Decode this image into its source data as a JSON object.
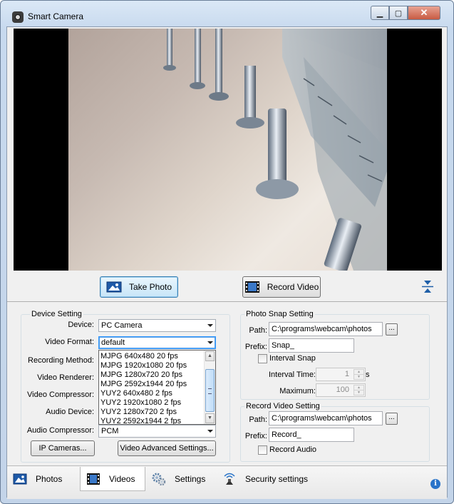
{
  "window": {
    "title": "Smart Camera"
  },
  "actions": {
    "take_photo": "Take Photo",
    "record_video": "Record Video"
  },
  "device_setting": {
    "legend": "Device Setting",
    "device_label": "Device:",
    "device_value": "PC Camera",
    "video_format_label": "Video Format:",
    "video_format_value": "default",
    "video_format_options": [
      "MJPG 640x480 20 fps",
      "MJPG 1920x1080 20 fps",
      "MJPG 1280x720 20 fps",
      "MJPG 2592x1944 20 fps",
      "YUY2 640x480 2 fps",
      "YUY2 1920x1080 2 fps",
      "YUY2 1280x720 2 fps",
      "YUY2 2592x1944 2 fps"
    ],
    "recording_method_label": "Recording Method:",
    "video_renderer_label": "Video Renderer:",
    "video_compressor_label": "Video Compressor:",
    "audio_device_label": "Audio Device:",
    "audio_compressor_label": "Audio Compressor:",
    "audio_compressor_value": "PCM",
    "ip_cameras_button": "IP Cameras...",
    "video_advanced_button": "Video Advanced Settings..."
  },
  "photo_snap": {
    "legend": "Photo Snap Setting",
    "path_label": "Path:",
    "path_value": "C:\\programs\\webcam\\photos",
    "browse_label": "...",
    "prefix_label": "Prefix:",
    "prefix_value": "Snap_",
    "interval_snap_label": "Interval Snap",
    "interval_time_label": "Interval Time:",
    "interval_time_value": "1",
    "interval_unit": "s",
    "maximum_label": "Maximum:",
    "maximum_value": "100"
  },
  "record_video": {
    "legend": "Record Video Setting",
    "path_label": "Path:",
    "path_value": "C:\\programs\\webcam\\photos",
    "browse_label": "...",
    "prefix_label": "Prefix:",
    "prefix_value": "Record_",
    "record_audio_label": "Record Audio"
  },
  "tabs": [
    {
      "label": "Photos",
      "icon": "photo-icon",
      "active": false
    },
    {
      "label": "Videos",
      "icon": "film-icon",
      "active": true
    },
    {
      "label": "Settings",
      "icon": "gears-icon",
      "active": false
    },
    {
      "label": "Security settings",
      "icon": "security-icon",
      "active": false
    }
  ],
  "colors": {
    "accent": "#3399ff",
    "info": "#2a74c9"
  }
}
